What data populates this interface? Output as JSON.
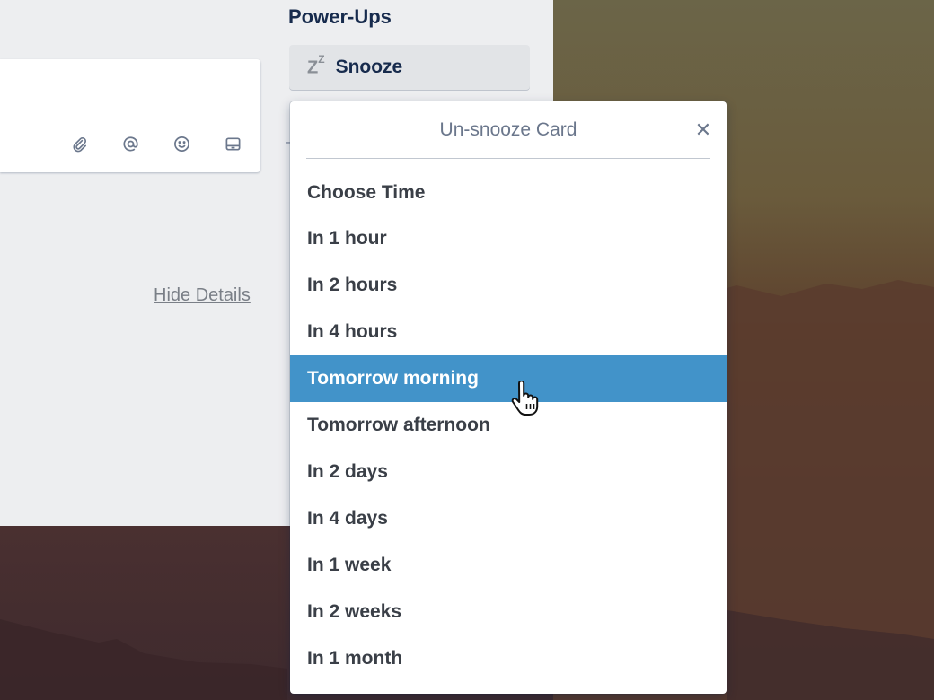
{
  "card": {
    "hide_details_label": "Hide Details",
    "comment_tools": [
      {
        "icon": "paperclip-icon"
      },
      {
        "icon": "at-mention-icon"
      },
      {
        "icon": "emoji-icon"
      },
      {
        "icon": "card-icon"
      }
    ]
  },
  "powerups": {
    "title": "Power-Ups",
    "snooze_button": {
      "icon": "snooze-icon",
      "label": "Snooze"
    }
  },
  "popover": {
    "title": "Un-snooze Card",
    "close_icon": "close-icon",
    "section_label": "Choose Time",
    "options": [
      {
        "label": "In 1 hour"
      },
      {
        "label": "In 2 hours"
      },
      {
        "label": "In 4 hours"
      },
      {
        "label": "Tomorrow morning",
        "active": true
      },
      {
        "label": "Tomorrow afternoon"
      },
      {
        "label": "In 2 days"
      },
      {
        "label": "In 4 days"
      },
      {
        "label": "In 1 week"
      },
      {
        "label": "In 2 weeks"
      },
      {
        "label": "In 1 month"
      }
    ]
  },
  "colors": {
    "highlight": "#4293c9",
    "panel_bg": "#edeef0",
    "text_dark": "#172b4d"
  }
}
